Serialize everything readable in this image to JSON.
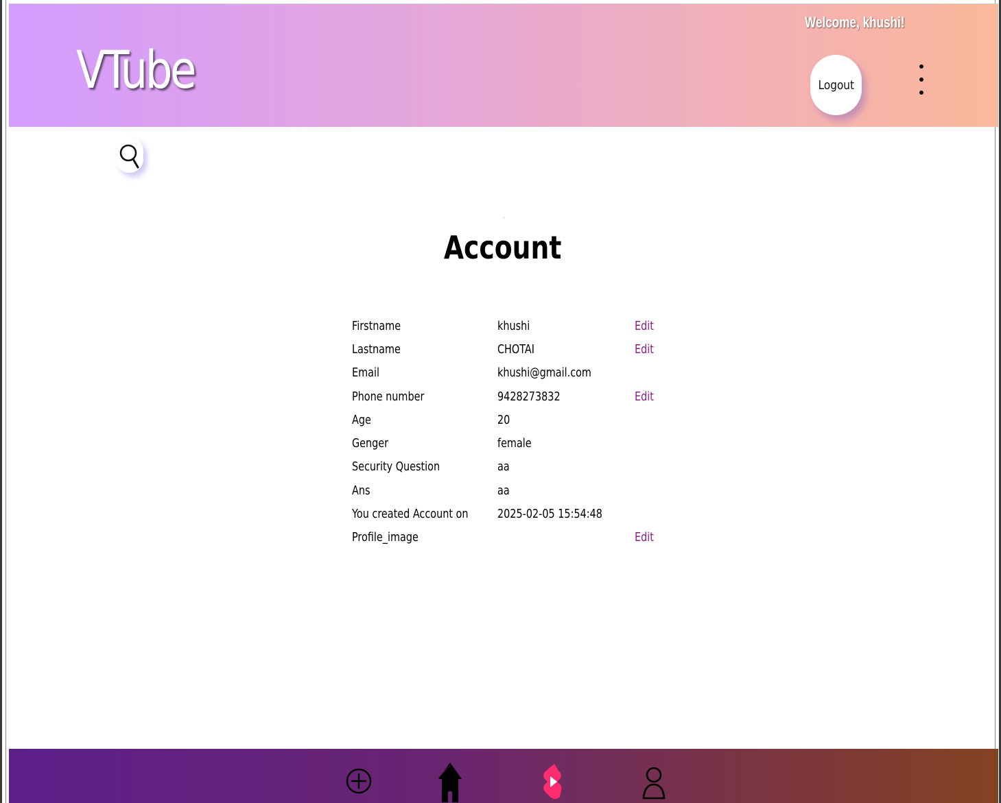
{
  "header": {
    "logo": "VTube",
    "welcome": "Welcome, khushi!",
    "logout_label": "Logout",
    "menu_icon": "more-vertical-icon",
    "gradient_colors": [
      "#d49cff",
      "#fbb89a"
    ]
  },
  "search": {
    "icon": "search-icon"
  },
  "main": {
    "title": "Account",
    "rows": [
      {
        "label": "Firstname",
        "value": "khushi",
        "action": "Edit"
      },
      {
        "label": "Lastname",
        "value": "CHOTAI",
        "action": "Edit"
      },
      {
        "label": "Email",
        "value": "khushi@gmail.com",
        "action": ""
      },
      {
        "label": "Phone number",
        "value": "9428273832",
        "action": "Edit"
      },
      {
        "label": "Age",
        "value": "20",
        "action": ""
      },
      {
        "label": "Genger",
        "value": "female",
        "action": ""
      },
      {
        "label": "Security Question",
        "value": "aa",
        "action": ""
      },
      {
        "label": "Ans",
        "value": "aa",
        "action": ""
      },
      {
        "label": "You created Account on",
        "value": "2025-02-05 15:54:48",
        "action": ""
      },
      {
        "label": "Profile_image",
        "value": "",
        "action": "Edit"
      }
    ],
    "edit_color": "#8a1f8a"
  },
  "footer": {
    "icons": [
      "add-icon",
      "home-icon",
      "shorts-icon",
      "profile-icon"
    ],
    "accent": "#ff2d6f",
    "gradient_colors": [
      "#5c1f8a",
      "#844221"
    ]
  }
}
